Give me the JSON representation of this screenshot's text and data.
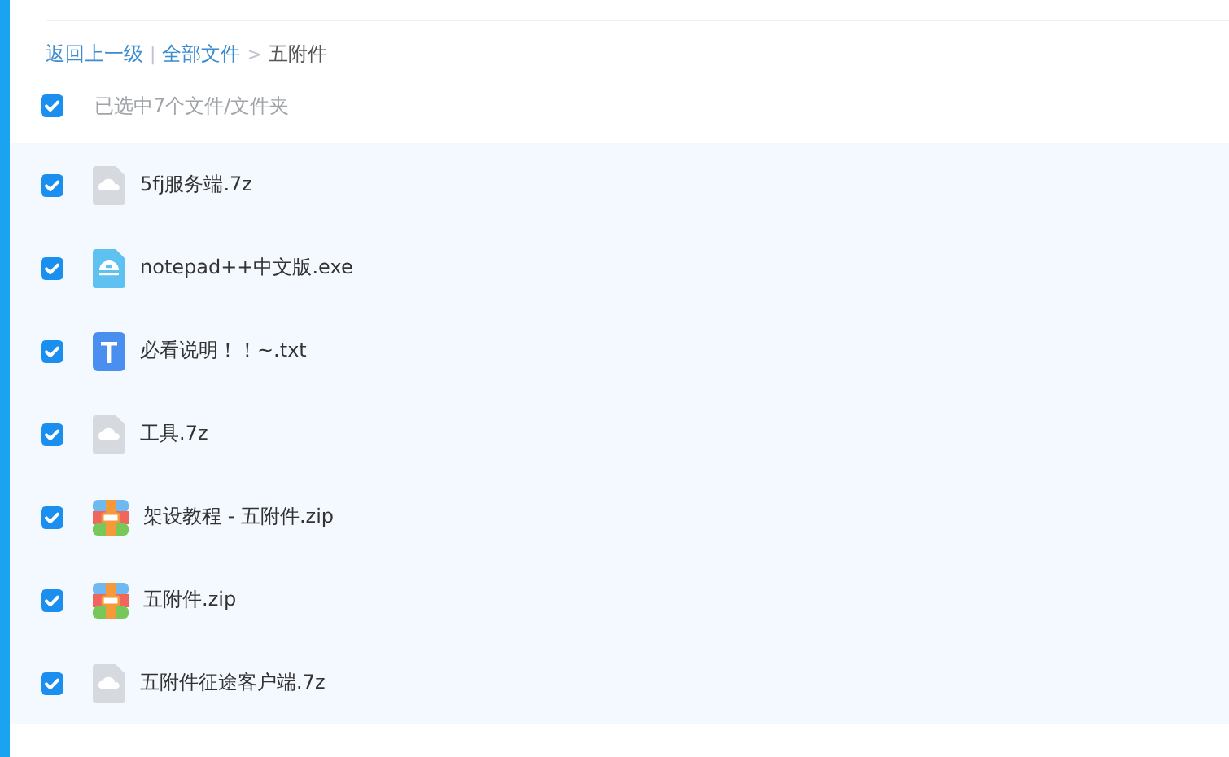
{
  "breadcrumb": {
    "back": "返回上一级",
    "separator": "|",
    "root": "全部文件",
    "arrow": ">",
    "current": "五附件"
  },
  "select_all": {
    "checked": true,
    "label": "已选中7个文件/文件夹"
  },
  "files": [
    {
      "name": "5fj服务端.7z",
      "kind": "archive",
      "checked": true
    },
    {
      "name": "notepad++中文版.exe",
      "kind": "exe",
      "checked": true
    },
    {
      "name": "必看说明！！~.txt",
      "kind": "txt",
      "checked": true
    },
    {
      "name": "工具.7z",
      "kind": "archive",
      "checked": true
    },
    {
      "name": "架设教程 - 五附件.zip",
      "kind": "zip",
      "checked": true
    },
    {
      "name": "五附件.zip",
      "kind": "zip",
      "checked": true
    },
    {
      "name": "五附件征途客户端.7z",
      "kind": "archive",
      "checked": true
    }
  ]
}
